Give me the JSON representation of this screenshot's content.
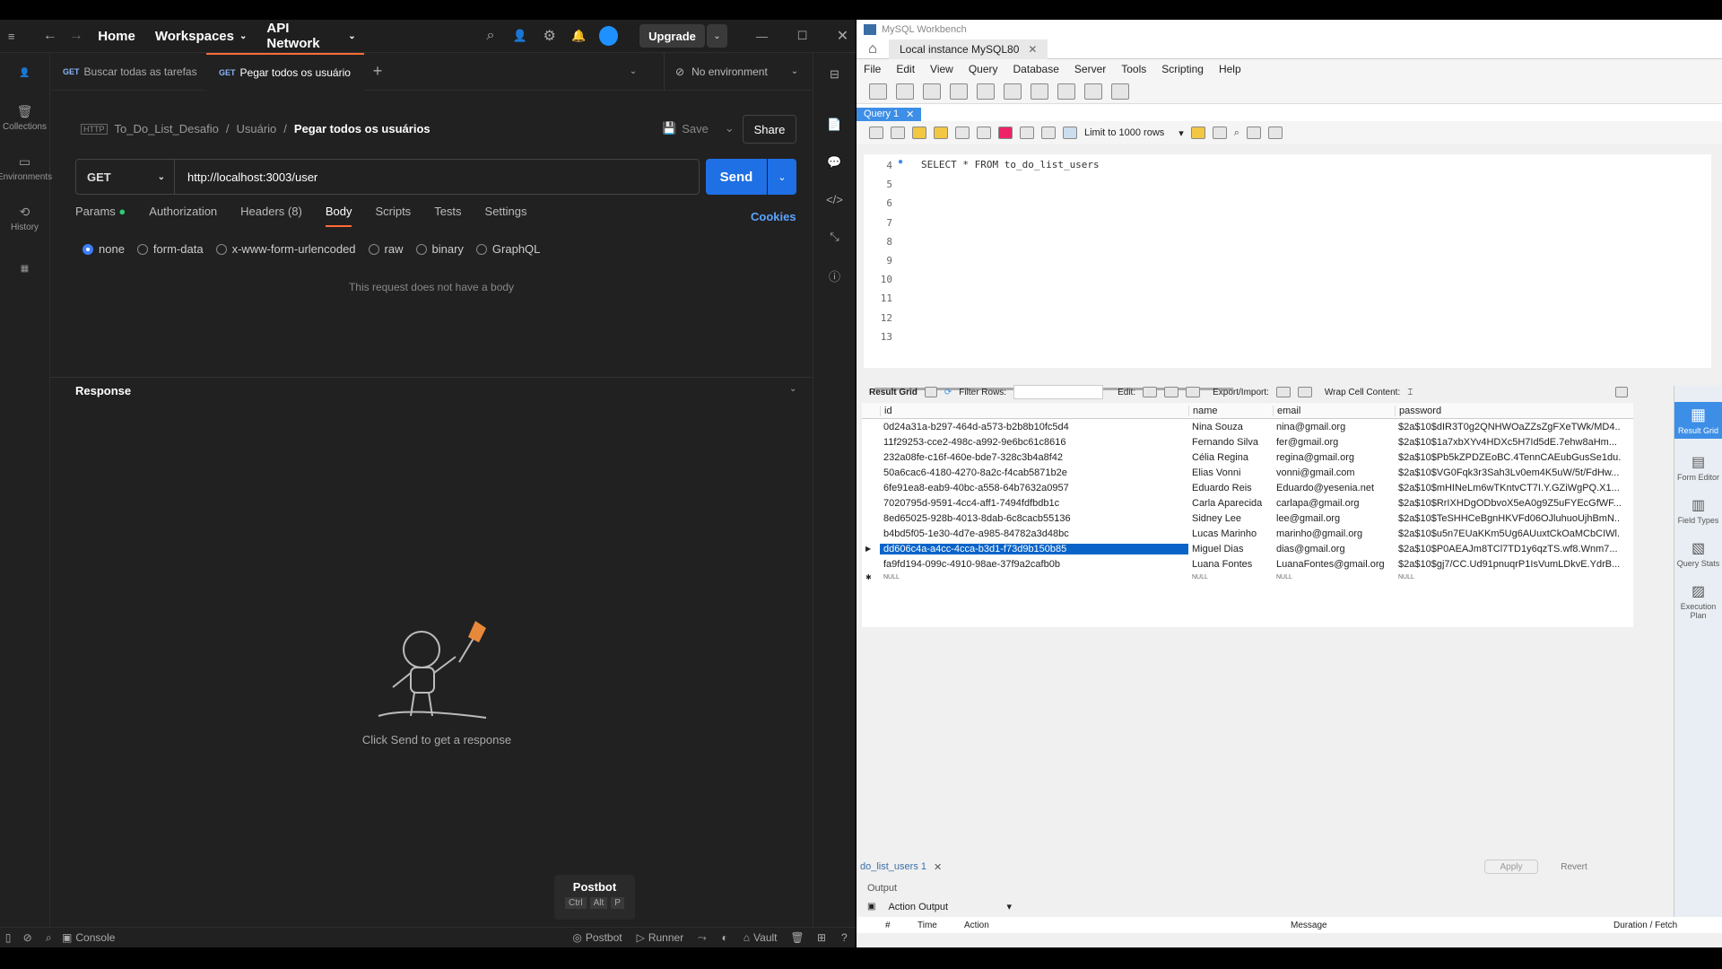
{
  "postman": {
    "topbar": {
      "home": "Home",
      "workspaces": "Workspaces",
      "api_network": "API Network",
      "upgrade": "Upgrade"
    },
    "rail": [
      {
        "label": "Collections"
      },
      {
        "label": "Environments"
      },
      {
        "label": "History"
      }
    ],
    "tabs": [
      {
        "method": "GET",
        "label": "Buscar todas as tarefas"
      },
      {
        "method": "GET",
        "label": "Pegar todos os usuário"
      }
    ],
    "environment": "No environment",
    "breadcrumb": {
      "collection": "To_Do_List_Desafio",
      "folder": "Usuário",
      "request": "Pegar todos os usuários"
    },
    "save": "Save",
    "share": "Share",
    "request": {
      "method": "GET",
      "url": "http://localhost:3003/user",
      "send": "Send"
    },
    "subtabs": {
      "params": "Params",
      "authorization": "Authorization",
      "headers": "Headers (8)",
      "body": "Body",
      "scripts": "Scripts",
      "tests": "Tests",
      "settings": "Settings",
      "cookies": "Cookies"
    },
    "body_options": [
      "none",
      "form-data",
      "x-www-form-urlencoded",
      "raw",
      "binary",
      "GraphQL"
    ],
    "no_body": "This request does not have a body",
    "response": {
      "title": "Response",
      "hint": "Click Send to get a response"
    },
    "postbot": {
      "title": "Postbot",
      "keys": [
        "Ctrl",
        "Alt",
        "P"
      ]
    },
    "bottom": {
      "console": "Console",
      "postbot": "Postbot",
      "runner": "Runner",
      "vault": "Vault"
    }
  },
  "workbench": {
    "title": "MySQL Workbench",
    "conn_tab": "Local instance MySQL80",
    "menu": [
      "File",
      "Edit",
      "View",
      "Query",
      "Database",
      "Server",
      "Tools",
      "Scripting",
      "Help"
    ],
    "query_tab": "Query 1",
    "limit": "Limit to 1000 rows",
    "editor": {
      "line_numbers": [
        "4",
        "5",
        "6",
        "7",
        "8",
        "9",
        "10",
        "11",
        "12",
        "13"
      ],
      "sql": "SELECT * FROM to_do_list_users"
    },
    "result": {
      "result_grid": "Result Grid",
      "filter_rows": "Filter Rows:",
      "edit": "Edit:",
      "export_import": "Export/Import:",
      "wrap": "Wrap Cell Content:",
      "columns": [
        "id",
        "name",
        "email",
        "password"
      ],
      "rows": [
        [
          "0d24a31a-b297-464d-a573-b2b8b10fc5d4",
          "Nina Souza",
          "nina@gmail.org",
          "$2a$10$dIR3T0g2QNHWOaZZsZgFXeTWk/MD4..."
        ],
        [
          "11f29253-cce2-498c-a992-9e6bc61c8616",
          "Fernando Silva",
          "fer@gmail.org",
          "$2a$10$1a7xbXYv4HDXc5H7Id5dE.7ehw8aHm..."
        ],
        [
          "232a08fe-c16f-460e-bde7-328c3b4a8f42",
          "Célia Regina",
          "regina@gmail.org",
          "$2a$10$Pb5kZPDZEoBC.4TennCAEubGusSe1du..."
        ],
        [
          "50a6cac6-4180-4270-8a2c-f4cab5871b2e",
          "Elias Vonni",
          "vonni@gmail.com",
          "$2a$10$VG0Fqk3r3Sah3Lv0em4K5uW/5t/FdHw..."
        ],
        [
          "6fe91ea8-eab9-40bc-a558-64b7632a0957",
          "Eduardo Reis",
          "Eduardo@yesenia.net",
          "$2a$10$mHINeLm6wTKntvCT7I.Y.GZiWgPQ.X1..."
        ],
        [
          "7020795d-9591-4cc4-aff1-7494fdfbdb1c",
          "Carla Aparecida",
          "carlapa@gmail.org",
          "$2a$10$RrIXHDgODbvoX5eA0g9Z5uFYEcGfWF..."
        ],
        [
          "8ed65025-928b-4013-8dab-6c8cacb55136",
          "Sidney Lee",
          "lee@gmail.org",
          "$2a$10$TeSHHCeBgnHKVFd06OJluhuoUjhBmN..."
        ],
        [
          "b4bd5f05-1e30-4d7e-a985-84782a3d48bc",
          "Lucas Marinho",
          "marinho@gmail.org",
          "$2a$10$u5n7EUaKKm5Ug6AUuxtCkOaMCbCIWl..."
        ],
        [
          "dd606c4a-a4cc-4cca-b3d1-f73d9b150b85",
          "Miguel Dias",
          "dias@gmail.org",
          "$2a$10$P0AEAJm8TCl7TD1y6qzTS.wf8.Wnm7..."
        ],
        [
          "fa9fd194-099c-4910-98ae-37f9a2cafb0b",
          "Luana Fontes",
          "LuanaFontes@gmail.org",
          "$2a$10$gj7/CC.Ud91pnuqrP1IsVumLDkvE.YdrB..."
        ]
      ],
      "null": "NULL"
    },
    "side": [
      "Result Grid",
      "Form Editor",
      "Field Types",
      "Query Stats",
      "Execution Plan"
    ],
    "result_tab": "do_list_users 1",
    "apply": "Apply",
    "revert": "Revert",
    "output": {
      "title": "Output",
      "dropdown": "Action Output",
      "cols": [
        "#",
        "Time",
        "Action",
        "Message",
        "Duration / Fetch"
      ]
    }
  }
}
